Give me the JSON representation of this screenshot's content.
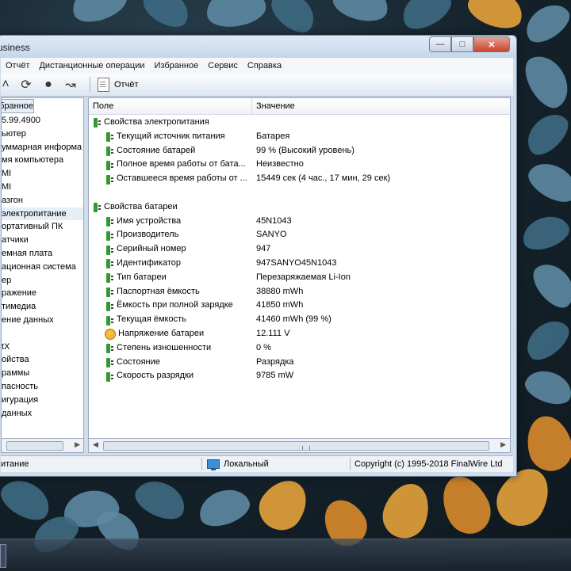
{
  "window": {
    "title": "usiness"
  },
  "menu": [
    "Отчёт",
    "Дистанционные операции",
    "Избранное",
    "Сервис",
    "Справка"
  ],
  "toolbar": {
    "report_label": "Отчёт"
  },
  "left_pane": {
    "tab_label": "бранное",
    "items": [
      "5.99.4900",
      "ьютер",
      "уммарная информа",
      "мя компьютера",
      "MI",
      "MI",
      "азгон",
      "электропитание",
      "ортативный ПК",
      "атчики",
      "емная плата",
      "ационная система",
      "ер",
      "ражение",
      "тимедиа",
      "ение данных",
      "",
      "tX",
      "ойства",
      "раммы",
      "пасность",
      "игурация",
      "данных"
    ]
  },
  "columns": {
    "field": "Поле",
    "value": "Значение"
  },
  "sections": [
    {
      "title": "Свойства электропитания",
      "rows": [
        {
          "field": "Текущий источник питания",
          "value": "Батарея"
        },
        {
          "field": "Состояние батарей",
          "value": "99 % (Высокий уровень)"
        },
        {
          "field": "Полное время работы от бата...",
          "value": "Неизвестно"
        },
        {
          "field": "Оставшееся время работы от ...",
          "value": "15449 сек (4 час., 17 мин, 29 сек)"
        }
      ]
    },
    {
      "title": "Свойства батареи",
      "rows": [
        {
          "field": "Имя устройства",
          "value": "45N1043"
        },
        {
          "field": "Производитель",
          "value": "SANYO"
        },
        {
          "field": "Серийный номер",
          "value": "947"
        },
        {
          "field": "Идентификатор",
          "value": "947SANYO45N1043"
        },
        {
          "field": "Тип батареи",
          "value": "Перезаряжаемая Li-Ion"
        },
        {
          "field": "Паспортная ёмкость",
          "value": "38880 mWh"
        },
        {
          "field": "Ёмкость при полной зарядке",
          "value": "41850 mWh"
        },
        {
          "field": "Текущая ёмкость",
          "value": "41460 mWh  (99 %)"
        },
        {
          "field": "Напряжение батареи",
          "value": "12.111 V",
          "icon": "voltage-icon"
        },
        {
          "field": "Степень изношенности",
          "value": "0 %"
        },
        {
          "field": "Состояние",
          "value": "Разрядка"
        },
        {
          "field": "Скорость разрядки",
          "value": "9785 mW"
        }
      ]
    }
  ],
  "statusbar": {
    "left": "итание",
    "middle": "Локальный",
    "right": "Copyright (c) 1995-2018 FinalWire Ltd"
  }
}
